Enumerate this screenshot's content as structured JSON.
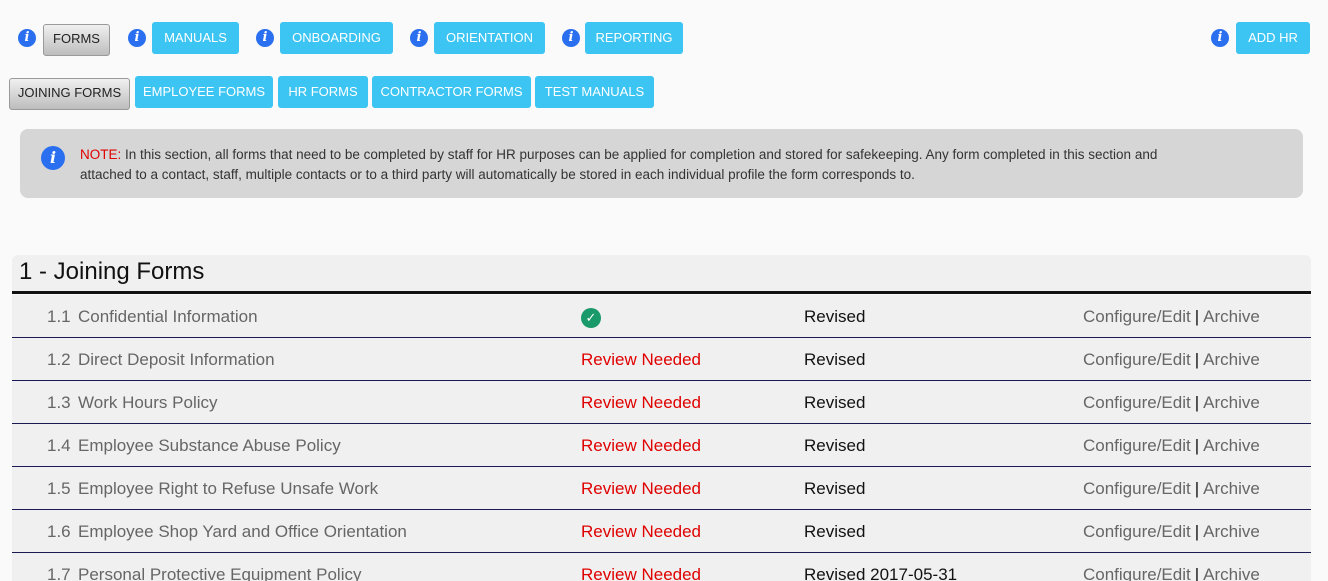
{
  "top_nav": {
    "forms": "FORMS",
    "manuals": "MANUALS",
    "onboarding": "ONBOARDING",
    "orientation": "ORIENTATION",
    "reporting": "REPORTING",
    "add_hr": "ADD HR"
  },
  "sub_nav": {
    "joining_forms": "JOINING FORMS",
    "employee_forms": "EMPLOYEE FORMS",
    "hr_forms": "HR FORMS",
    "contractor_forms": "CONTRACTOR FORMS",
    "test_manuals": "TEST MANUALS"
  },
  "note": {
    "label": "NOTE:",
    "text": " In this section, all forms that need to be completed by staff for HR purposes can be applied for completion and stored for safekeeping. Any form completed in this section and attached to a contact, staff, multiple contacts or to a third party will automatically be stored in each individual profile the form corresponds to."
  },
  "section": {
    "title": "1 - Joining Forms"
  },
  "actions": {
    "configure": "Configure/Edit",
    "separator": "|",
    "archive": "Archive"
  },
  "rows": [
    {
      "num": "1.1",
      "name": "Confidential Information",
      "status": "",
      "reviewed": true,
      "revised": "Revised"
    },
    {
      "num": "1.2",
      "name": "Direct Deposit Information",
      "status": "Review Needed",
      "reviewed": false,
      "revised": "Revised"
    },
    {
      "num": "1.3",
      "name": "Work Hours Policy",
      "status": "Review Needed",
      "reviewed": false,
      "revised": "Revised"
    },
    {
      "num": "1.4",
      "name": "Employee Substance Abuse Policy",
      "status": "Review Needed",
      "reviewed": false,
      "revised": "Revised"
    },
    {
      "num": "1.5",
      "name": "Employee Right to Refuse Unsafe Work",
      "status": "Review Needed",
      "reviewed": false,
      "revised": "Revised"
    },
    {
      "num": "1.6",
      "name": "Employee Shop Yard and Office Orientation",
      "status": "Review Needed",
      "reviewed": false,
      "revised": "Revised"
    },
    {
      "num": "1.7",
      "name": "Personal Protective Equipment Policy",
      "status": "Review Needed",
      "reviewed": false,
      "revised": "Revised 2017-05-31"
    }
  ],
  "colors": {
    "accent": "#3cc4f2",
    "info": "#2a6ff0",
    "alert": "#e00000",
    "success": "#1a9a6a"
  }
}
